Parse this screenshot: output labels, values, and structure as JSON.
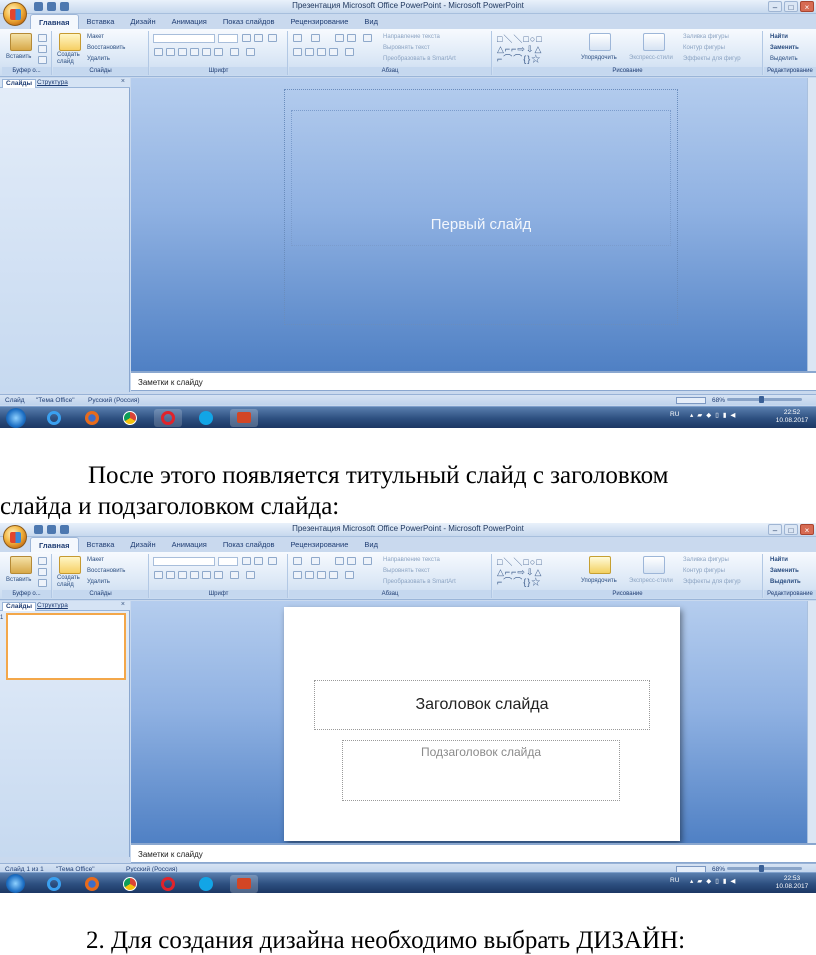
{
  "window": {
    "title": "Презентация Microsoft Office PowerPoint - Microsoft PowerPoint",
    "controls": [
      "–",
      "□",
      "×"
    ]
  },
  "ribbon": {
    "tabs": [
      "Главная",
      "Вставка",
      "Дизайн",
      "Анимация",
      "Показ слайдов",
      "Рецензирование",
      "Вид"
    ],
    "clipboard": {
      "paste": "Вставить",
      "label": "Буфер о..."
    },
    "slides": {
      "new_slide_line1": "Создать",
      "new_slide_line2": "слайд",
      "layout": "Макет",
      "reset": "Восстановить",
      "delete": "Удалить",
      "label": "Слайды"
    },
    "font": {
      "label": "Шрифт"
    },
    "paragraph": {
      "text_direction": "Направление текста",
      "align_text": "Выровнять текст",
      "convert_smartart": "Преобразовать в SmartArt",
      "label": "Абзац"
    },
    "drawing": {
      "arrange": "Упорядочить",
      "quick_styles": "Экспресс-стили",
      "shape_fill": "Заливка фигуры",
      "shape_outline": "Контур фигуры",
      "shape_effects": "Эффекты для фигур",
      "label": "Рисование"
    },
    "editing": {
      "find": "Найти",
      "replace": "Заменить",
      "select": "Выделить",
      "label": "Редактирование"
    }
  },
  "left_pane": {
    "tab_slides": "Слайды",
    "tab_outline": "Структура",
    "close": "×"
  },
  "screenshot1": {
    "slide_text": "Первый слайд",
    "notes": "Заметки к слайду",
    "status": [
      "Слайд",
      "\"Тема Office\"",
      "Русский (Россия)"
    ],
    "zoom": "68%",
    "clock_time": "22:52",
    "clock_date": "10.08.2017",
    "lang": "RU"
  },
  "paragraph1": {
    "line1": "После этого появляется титульный слайд с заголовком",
    "line2": "слайда и подзаголовком слайда:"
  },
  "screenshot2": {
    "thumb_number": "1",
    "title_placeholder": "Заголовок слайда",
    "subtitle_placeholder": "Подзаголовок слайда",
    "notes": "Заметки к слайду",
    "status": [
      "Слайд 1 из 1",
      "\"Тема Office\"",
      "Русский (Россия)"
    ],
    "zoom": "68%",
    "clock_time": "22:53",
    "clock_date": "10.08.2017",
    "lang": "RU"
  },
  "paragraph2": {
    "line1": "2. Для создания дизайна необходимо выбрать ДИЗАЙН:"
  },
  "colors": {
    "ribbon_blue": "#c9dbf0",
    "canvas_blue": "#8fb1e2",
    "taskbar": "#2d4f80",
    "thumb_border": "#f3a74a"
  },
  "icons": [
    "office-button-icon",
    "ie-icon",
    "firefox-icon",
    "chrome-icon",
    "opera-icon",
    "skype-icon",
    "powerpoint-icon",
    "windows-start-icon"
  ]
}
